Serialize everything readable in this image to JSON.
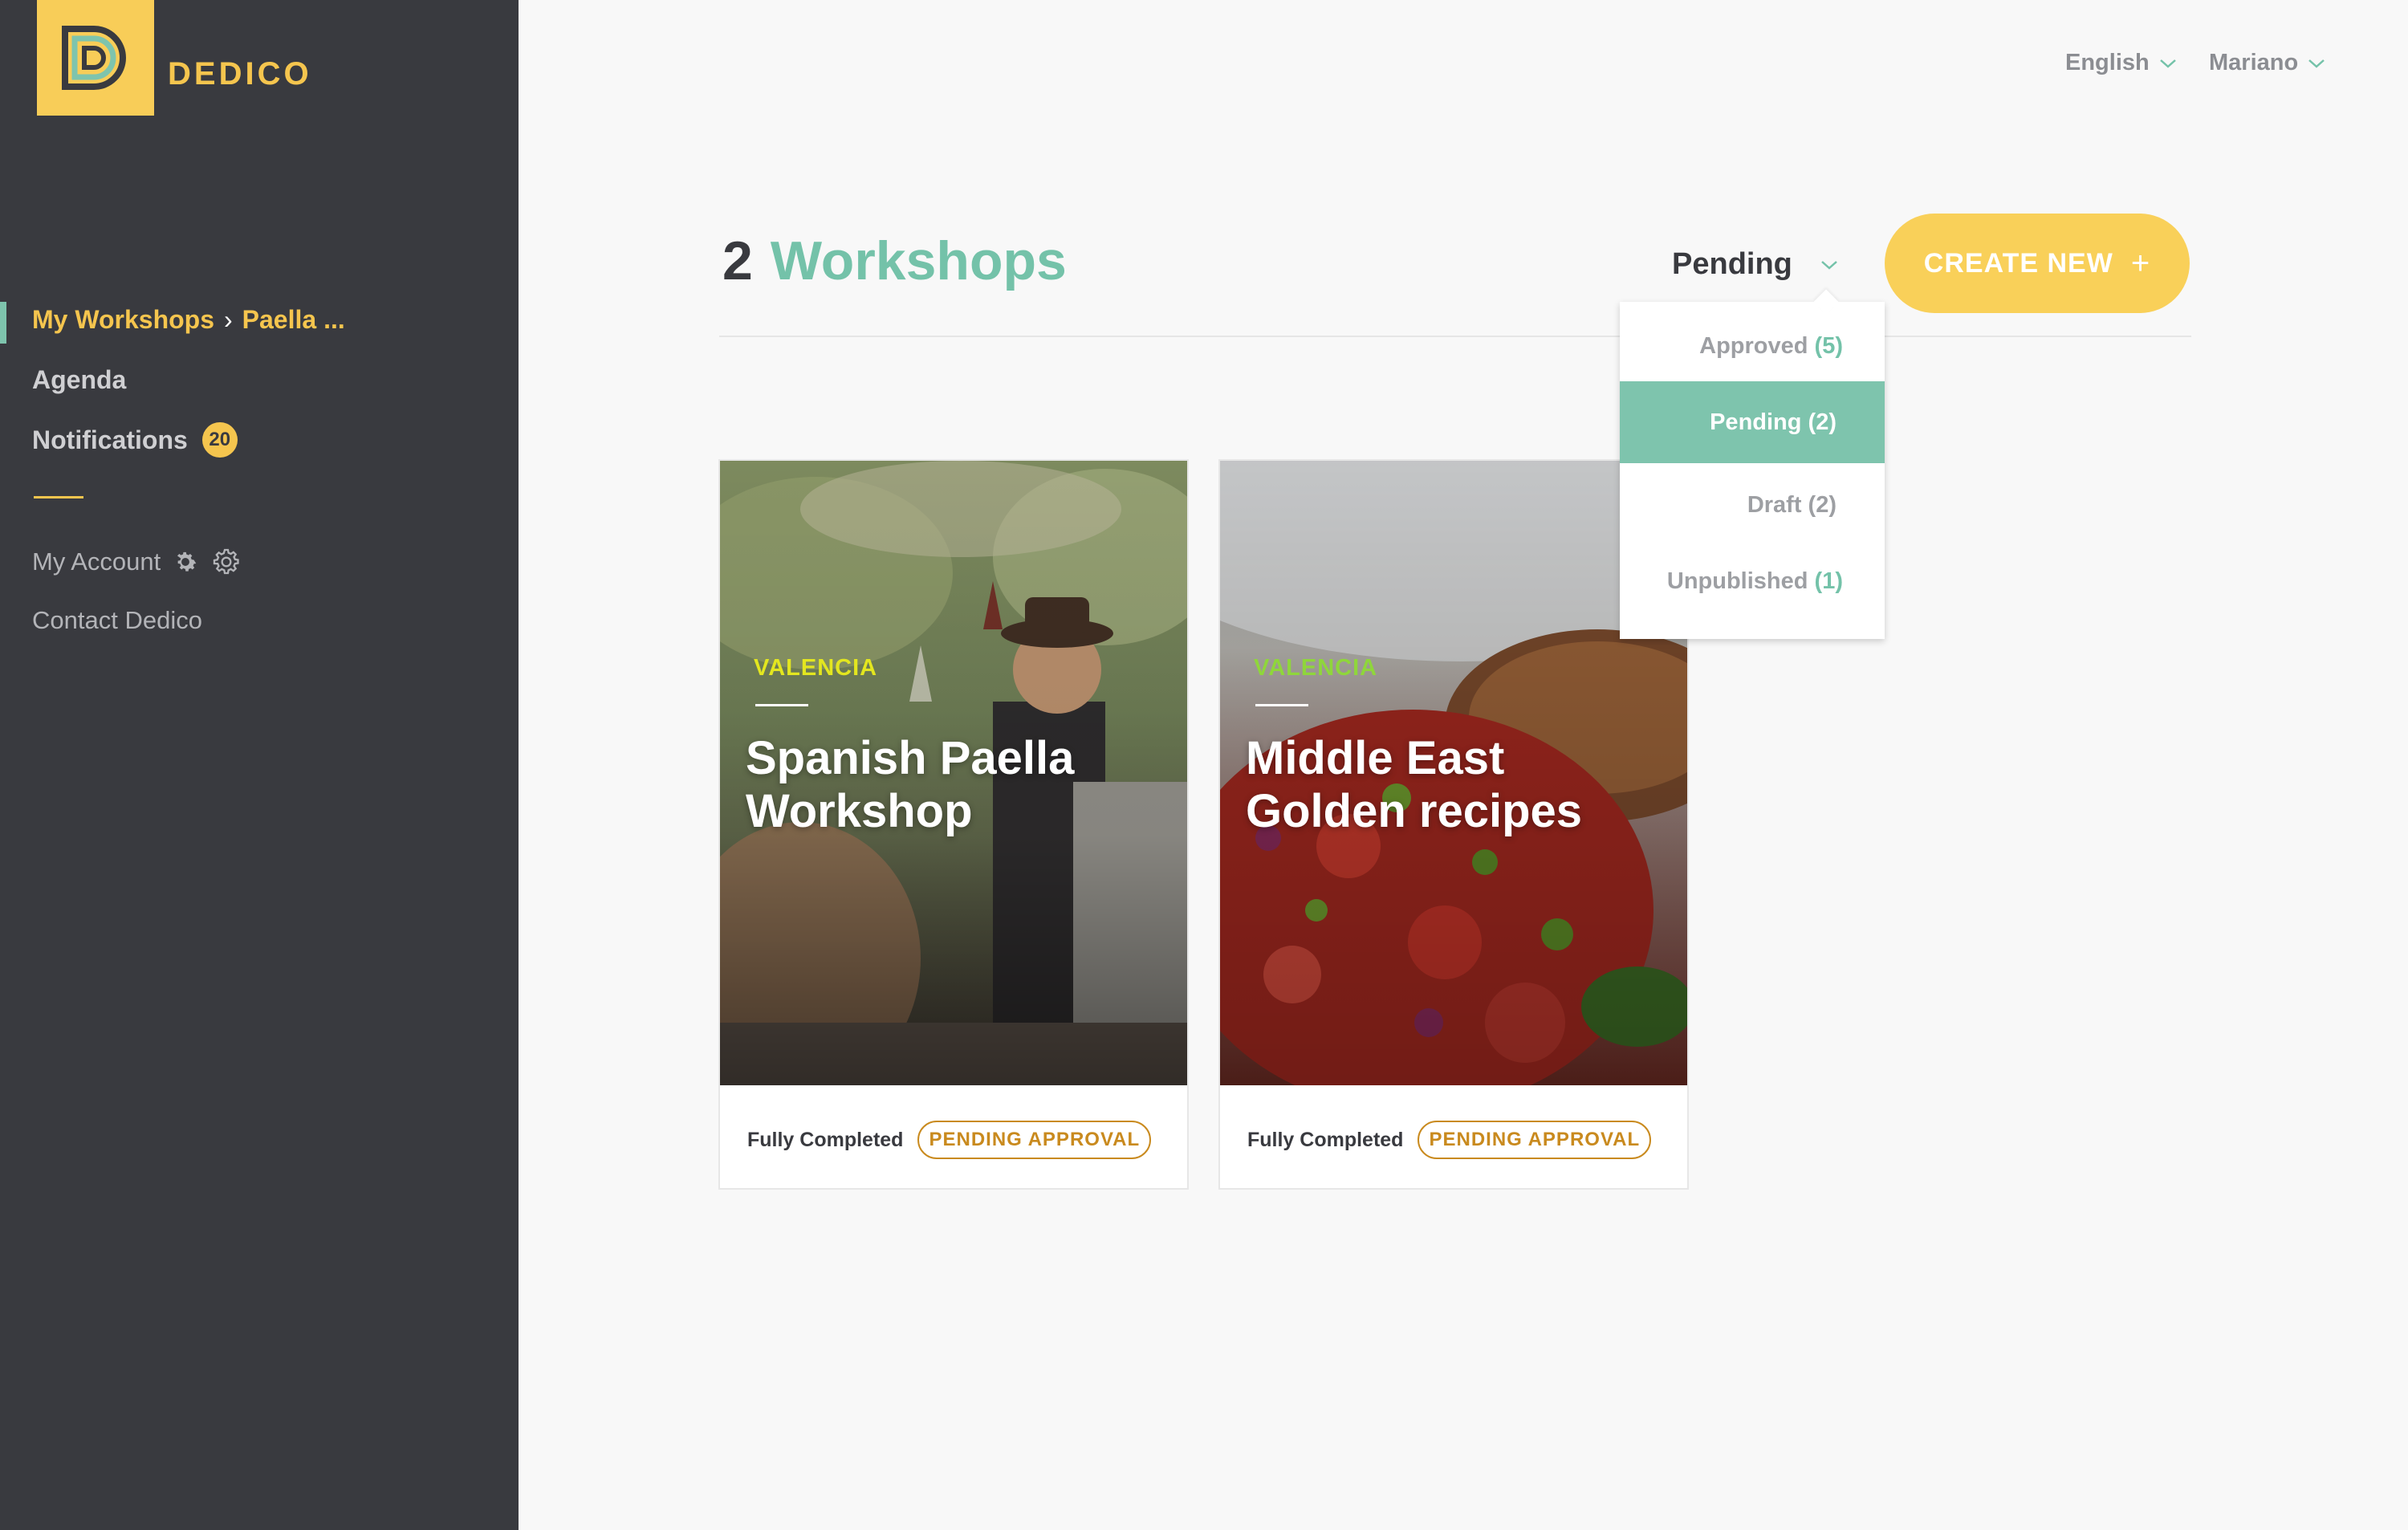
{
  "brand": {
    "name": "DEDICO",
    "logo_color": "#f8cd58"
  },
  "sidebar": {
    "breadcrumb": {
      "root": "My Workshops",
      "separator": "›",
      "current": "Paella ..."
    },
    "nav": [
      {
        "label": "Agenda"
      },
      {
        "label": "Notifications",
        "badge": "20"
      }
    ],
    "account": {
      "label": "My Account",
      "icons": [
        "cog-filled-icon",
        "cog-outline-icon"
      ]
    },
    "contact": {
      "label": "Contact Dedico"
    }
  },
  "topbar": {
    "language": "English",
    "user": "Mariano"
  },
  "header": {
    "count": "2",
    "title": "Workshops",
    "filter_value": "Pending",
    "create_button": "CREATE NEW",
    "create_icon": "+"
  },
  "dropdown": {
    "options": [
      {
        "label": "Approved",
        "count": "(5)",
        "selected": false
      },
      {
        "label": "Pending",
        "count": "(2)",
        "selected": true
      },
      {
        "label": "Draft",
        "count": "(2)",
        "selected": false
      },
      {
        "label": "Unpublished",
        "count": "(1)",
        "selected": false
      }
    ]
  },
  "workshops": [
    {
      "city": "VALENCIA",
      "city_color": "#e3e61f",
      "title": "Spanish Paella Workshop",
      "completion": "Fully Completed",
      "status": "PENDING APPROVAL"
    },
    {
      "city": "VALENCIA",
      "city_color": "#8fd63b",
      "title": "Middle East Golden recipes",
      "completion": "Fully Completed",
      "status": "PENDING APPROVAL"
    }
  ],
  "colors": {
    "sidebar_bg": "#393a3f",
    "accent_yellow": "#f5c54e",
    "accent_teal": "#74c2a9",
    "pending_orange": "#c98a1e"
  }
}
